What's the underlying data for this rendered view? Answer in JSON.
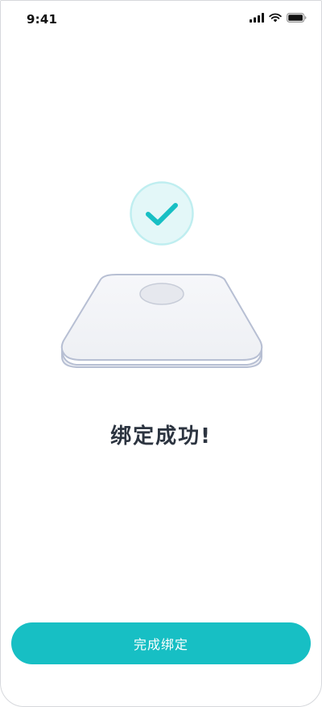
{
  "status_bar": {
    "time": "9:41",
    "icons": [
      "signal-icon",
      "wifi-icon",
      "battery-icon"
    ]
  },
  "illustration": {
    "badge_icon": "checkmark-icon",
    "device_icon": "smart-scale-icon"
  },
  "main": {
    "title": "绑定成功!"
  },
  "actions": {
    "finish_label": "完成绑定"
  },
  "colors": {
    "accent": "#17bfc4",
    "check_bg": "#e3f7f8",
    "check_ring": "#bfeef0",
    "title": "#2c3440",
    "scale_outline": "#b7bfd3"
  }
}
